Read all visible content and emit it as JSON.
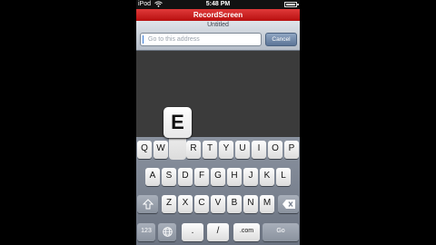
{
  "status_bar": {
    "carrier": "iPod",
    "time": "5:48 PM"
  },
  "app": {
    "title": "RecordScreen"
  },
  "browser": {
    "doc_title": "Untitled",
    "address_placeholder": "Go to this address",
    "cancel_label": "Cancel"
  },
  "keyboard": {
    "popup_key": "E",
    "row1": [
      "Q",
      "W",
      "E",
      "R",
      "T",
      "Y",
      "U",
      "I",
      "O",
      "P"
    ],
    "row2": [
      "A",
      "S",
      "D",
      "F",
      "G",
      "H",
      "J",
      "K",
      "L"
    ],
    "row3": [
      "Z",
      "X",
      "C",
      "V",
      "B",
      "N",
      "M"
    ],
    "row4": {
      "numbers": "123",
      "dot": ".",
      "slash": "/",
      "dotcom": ".com",
      "go": "Go"
    },
    "icons": {
      "shift": "shift-arrow-icon",
      "backspace": "backspace-icon",
      "globe": "globe-icon"
    }
  }
}
